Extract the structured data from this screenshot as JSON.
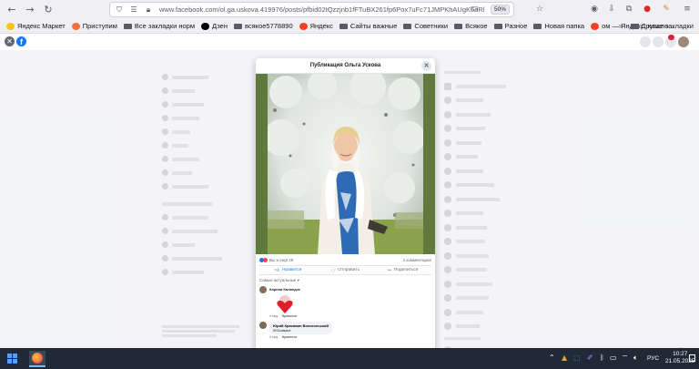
{
  "browser": {
    "url": "www.facebook.com/ol.ga.uskova.419976/posts/pfbid02tQzzjnb1fFTuBX261fp6Pox7uFc71JMPKhAUgK6aRl",
    "zoom": "50%",
    "bookmarks": [
      {
        "label": "Яндекс Маркет",
        "icon_color": "#f5c518"
      },
      {
        "label": "Приступим",
        "icon_color": "#ff6d3a"
      },
      {
        "label": "Все закладки норм",
        "icon_color": "folder"
      },
      {
        "label": "Дзен",
        "icon_color": "#000000"
      },
      {
        "label": "всякое5778890",
        "icon_color": "folder"
      },
      {
        "label": "Яндекс",
        "icon_color": "#fc3f1d"
      },
      {
        "label": "Сайты важные",
        "icon_color": "folder"
      },
      {
        "label": "Советники",
        "icon_color": "folder"
      },
      {
        "label": "Всякое",
        "icon_color": "folder"
      },
      {
        "label": "Разное",
        "icon_color": "folder"
      },
      {
        "label": "Новая папка",
        "icon_color": "folder"
      },
      {
        "label": "ом — Яндекс: нашло...",
        "icon_color": "#fc3f1d"
      }
    ],
    "other_bookmarks": "Другие закладки"
  },
  "modal": {
    "title": "Публикация Ольга Ускова",
    "reactions_text": "Вы и ещё 28",
    "comments_count": "2 комментария",
    "like_label": "Нравится",
    "comment_label": "Отправить",
    "share_label": "Поделиться",
    "sort_label": "Самые актуальные ▾",
    "comments": [
      {
        "author": "Карина Каландзе",
        "text": "",
        "time": "4 нед.",
        "action": "Нравится"
      },
      {
        "author": "Юрий Красавин Вологольский",
        "text": "!!!!Сильно!",
        "time": "4 нед.",
        "action": "Нравится"
      }
    ]
  },
  "taskbar": {
    "language": "РУС",
    "time": "10:27",
    "date": "21.05.2025"
  }
}
